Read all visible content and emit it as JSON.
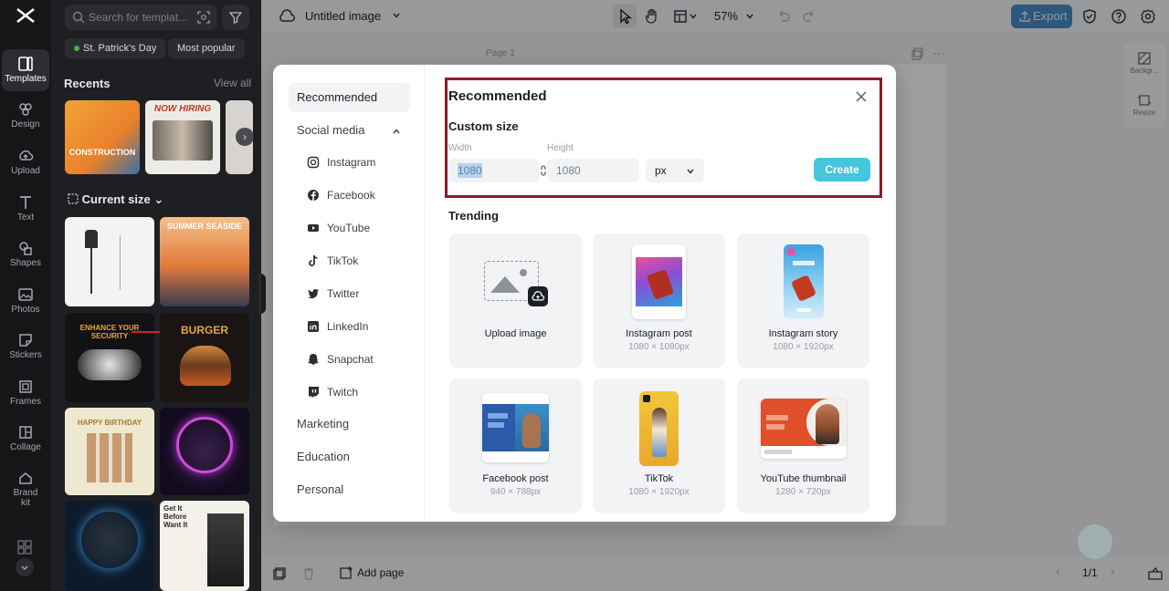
{
  "app": {
    "doc_title": "Untitled image",
    "zoom": "57%",
    "export_label": "Export",
    "page_label": "Page 1",
    "add_page_label": "Add page",
    "page_count": "1/1"
  },
  "rail": {
    "items": [
      {
        "label": "Templates"
      },
      {
        "label": "Design"
      },
      {
        "label": "Upload"
      },
      {
        "label": "Text"
      },
      {
        "label": "Shapes"
      },
      {
        "label": "Photos"
      },
      {
        "label": "Stickers"
      },
      {
        "label": "Frames"
      },
      {
        "label": "Collage"
      },
      {
        "label": "Brand kit"
      }
    ]
  },
  "panel": {
    "search_placeholder": "Search for templat...",
    "chips": [
      "St. Patrick's Day",
      "Most popular"
    ],
    "recents_title": "Recents",
    "view_all": "View all",
    "current_size_title": "Current size",
    "thumb_texts": [
      "CONSTRUCTION",
      "NOW HIRING",
      "SUMMER SEASIDE",
      "ENHANCE YOUR SECURITY",
      "BURGER",
      "HAPPY BIRTHDAY",
      "Get It Before Want It"
    ]
  },
  "right_tools": [
    "Backgr...",
    "Resize"
  ],
  "dialog": {
    "nav": {
      "recommended": "Recommended",
      "social_media": "Social media",
      "social_items": [
        "Instagram",
        "Facebook",
        "YouTube",
        "TikTok",
        "Twitter",
        "LinkedIn",
        "Snapchat",
        "Twitch"
      ],
      "marketing": "Marketing",
      "education": "Education",
      "personal": "Personal"
    },
    "title": "Recommended",
    "custom_size": "Custom size",
    "width_label": "Width",
    "height_label": "Height",
    "width_value": "1080",
    "height_value": "1080",
    "unit": "px",
    "create_label": "Create",
    "trending_title": "Trending",
    "cards": [
      {
        "name": "Upload image",
        "size": ""
      },
      {
        "name": "Instagram post",
        "size": "1080 × 1080px"
      },
      {
        "name": "Instagram story",
        "size": "1080 × 1920px"
      },
      {
        "name": "Facebook post",
        "size": "940 × 788px"
      },
      {
        "name": "TikTok",
        "size": "1080 × 1920px"
      },
      {
        "name": "YouTube thumbnail",
        "size": "1280 × 720px"
      }
    ]
  },
  "colors": {
    "accent": "#44c6dd",
    "highlight": "#8a1c2c",
    "export": "#4a8fc9"
  }
}
